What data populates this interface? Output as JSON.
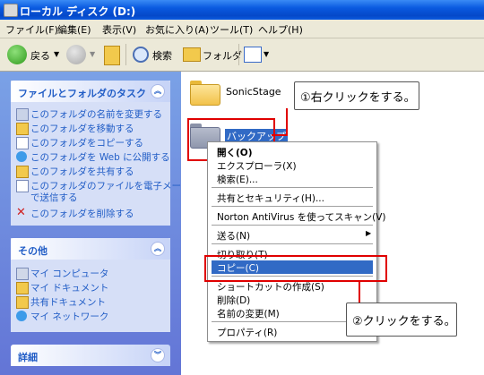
{
  "window": {
    "title": "ローカル ディスク (D:)"
  },
  "menu": [
    "ファイル(F)",
    "編集(E)",
    "表示(V)",
    "お気に入り(A)",
    "ツール(T)",
    "ヘルプ(H)"
  ],
  "toolbar": {
    "back": "戻る",
    "search": "検索",
    "folders": "フォルダ"
  },
  "tasks": {
    "title": "ファイルとフォルダのタスク",
    "items": [
      "このフォルダの名前を変更する",
      "このフォルダを移動する",
      "このフォルダをコピーする",
      "このフォルダを Web に公開する",
      "このフォルダを共有する",
      "このフォルダのファイルを電子メール",
      "で送信する",
      "このフォルダを削除する"
    ]
  },
  "other": {
    "title": "その他",
    "items": [
      "マイ コンピュータ",
      "マイ ドキュメント",
      "共有ドキュメント",
      "マイ ネットワーク"
    ]
  },
  "details": {
    "title": "詳細"
  },
  "folders": [
    "SonicStage",
    "バックアップ"
  ],
  "context_menu": [
    "開く(O)",
    "エクスプローラ(X)",
    "検索(E)...",
    "共有とセキュリティ(H)...",
    "Norton AntiVirus を使ってスキャン(V)",
    "送る(N)",
    "切り取り(T)",
    "コピー(C)",
    "ショートカットの作成(S)",
    "削除(D)",
    "名前の変更(M)",
    "プロパティ(R)"
  ],
  "callouts": {
    "step1": "①右クリックをする。",
    "step2": "②クリックをする。"
  },
  "colors": {
    "accent": "#e00000",
    "selection": "#316ac5",
    "task_text": "#215dc6"
  }
}
